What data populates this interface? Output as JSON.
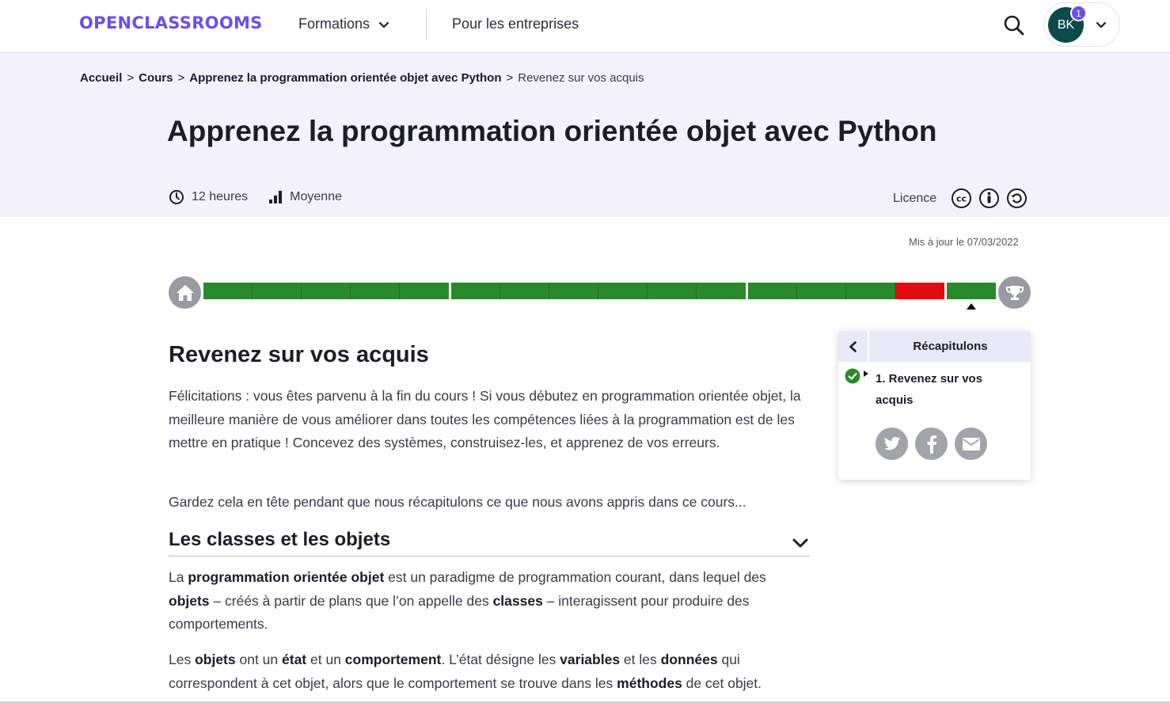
{
  "header": {
    "logo": "OPENCLASSROOMS",
    "nav_formations": "Formations",
    "nav_entreprises": "Pour les entreprises",
    "user_initials": "BK",
    "notification_count": "1"
  },
  "breadcrumb": {
    "items": [
      "Accueil",
      "Cours",
      "Apprenez la programmation orientée objet avec Python"
    ],
    "separator": ">",
    "current": "Revenez sur vos acquis"
  },
  "course": {
    "title": "Apprenez la programmation orientée objet avec Python",
    "duration": "12 heures",
    "difficulty": "Moyenne",
    "licence_label": "Licence",
    "licence_icons": [
      "cc-icon",
      "by-icon",
      "sa-icon"
    ],
    "updated": "Mis à jour le 07/03/2022"
  },
  "progress": {
    "parts": [
      [
        "done",
        "done",
        "done",
        "done",
        "done"
      ],
      [
        "done",
        "done",
        "done",
        "done",
        "done",
        "done"
      ],
      [
        "done",
        "done",
        "done",
        "fail"
      ],
      [
        "done"
      ]
    ],
    "colors": {
      "done": "#2a8a2a",
      "fail": "#e00d0d",
      "marker": "#111111"
    }
  },
  "chapter": {
    "title": "Revenez sur vos acquis",
    "intro": "Félicitations : vous êtes parvenu à la fin du cours ! Si vous débutez en programmation orientée objet, la meilleure manière de vous améliorer dans toutes les compétences liées à la programmation est de les mettre en pratique ! Concevez des systèmes, construisez-les, et apprenez de vos erreurs.",
    "intro2": "Gardez cela en tête pendant que nous récapitulons ce que nous avons appris dans ce cours...",
    "section_title": "Les classes et les objets",
    "p1": {
      "t1": "La ",
      "b1": "programmation orientée objet",
      "t2": " est un paradigme de programmation courant, dans lequel des ",
      "b2": "objets",
      "t3": " – créés à partir de plans que l’on appelle des ",
      "b3": "classes",
      "t4": " – interagissent pour produire des comportements."
    },
    "p2": {
      "t1": "Les ",
      "b1": "objets",
      "t2": " ont un ",
      "b2": "état",
      "t3": " et un ",
      "b3": "comportement",
      "t4": ". L’état désigne les ",
      "b4": "variables",
      "t5": " et les ",
      "b5": "données",
      "t6": " qui correspondent à cet objet, alors que le comportement se trouve dans les ",
      "b6": "méthodes",
      "t7": " de cet objet."
    }
  },
  "toc": {
    "title": "Récapitulons",
    "item_label": "1. Revenez sur vos acquis",
    "share_icons": [
      "twitter-icon",
      "facebook-icon",
      "email-icon"
    ]
  },
  "colors": {
    "brand": "#6b4ef0",
    "hero_bg": "#f2f1fc",
    "toc_head_bg": "#e9e8f7",
    "success": "#2a8a2a"
  }
}
